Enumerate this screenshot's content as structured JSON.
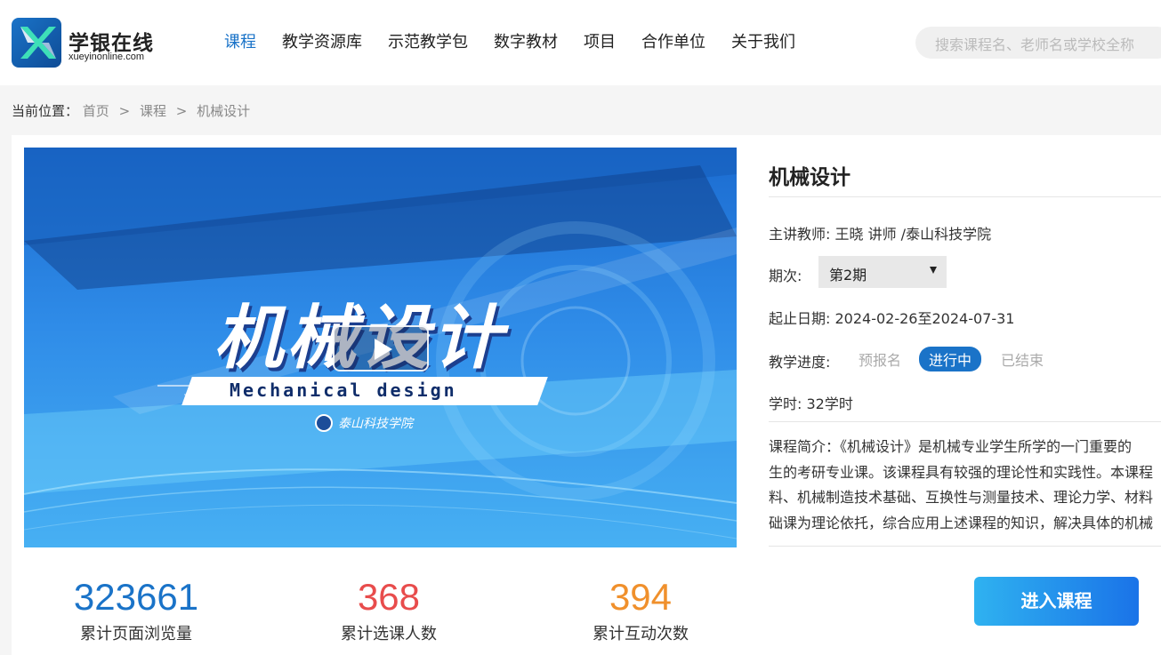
{
  "brand": {
    "name": "学银在线",
    "url": "xueyinonline.com"
  },
  "nav": [
    {
      "label": "课程",
      "active": true
    },
    {
      "label": "教学资源库",
      "active": false
    },
    {
      "label": "示范教学包",
      "active": false
    },
    {
      "label": "数字教材",
      "active": false
    },
    {
      "label": "项目",
      "active": false
    },
    {
      "label": "合作单位",
      "active": false
    },
    {
      "label": "关于我们",
      "active": false
    }
  ],
  "search": {
    "placeholder": "搜索课程名、老师名或学校全称"
  },
  "breadcrumb": {
    "prefix": "当前位置：",
    "items": [
      "首页",
      "课程",
      "机械设计"
    ],
    "separator": ">"
  },
  "cover": {
    "title": "机械设计",
    "subtitle": "Mechanical design",
    "school": "泰山科技学院"
  },
  "stats": [
    {
      "value": "323661",
      "label": "累计页面浏览量",
      "color": "#1a73c8"
    },
    {
      "value": "368",
      "label": "累计选课人数",
      "color": "#e84c4c"
    },
    {
      "value": "394",
      "label": "累计互动次数",
      "color": "#f0902c"
    }
  ],
  "course": {
    "title": "机械设计",
    "teacher_label": "主讲教师:",
    "teacher": "王晓 讲师 /泰山科技学院",
    "term_label": "期次:",
    "term": "第2期",
    "date_label": "起止日期:",
    "date": "2024-02-26至2024-07-31",
    "progress_label": "教学进度:",
    "progress_stages": [
      "预报名",
      "进行中",
      "已结束"
    ],
    "progress_current": "进行中",
    "hours_label": "学时:",
    "hours": "32学时",
    "intro_lines": [
      "课程简介：《机械设计》是机械专业学生所学的一门重要的",
      "生的考研专业课。该课程具有较强的理论性和实践性。本课程",
      "料、机械制造技术基础、互换性与测量技术、理论力学、材料",
      "础课为理论依托，综合应用上述课程的知识，解决具体的机械"
    ],
    "enter_label": "进入课程"
  }
}
